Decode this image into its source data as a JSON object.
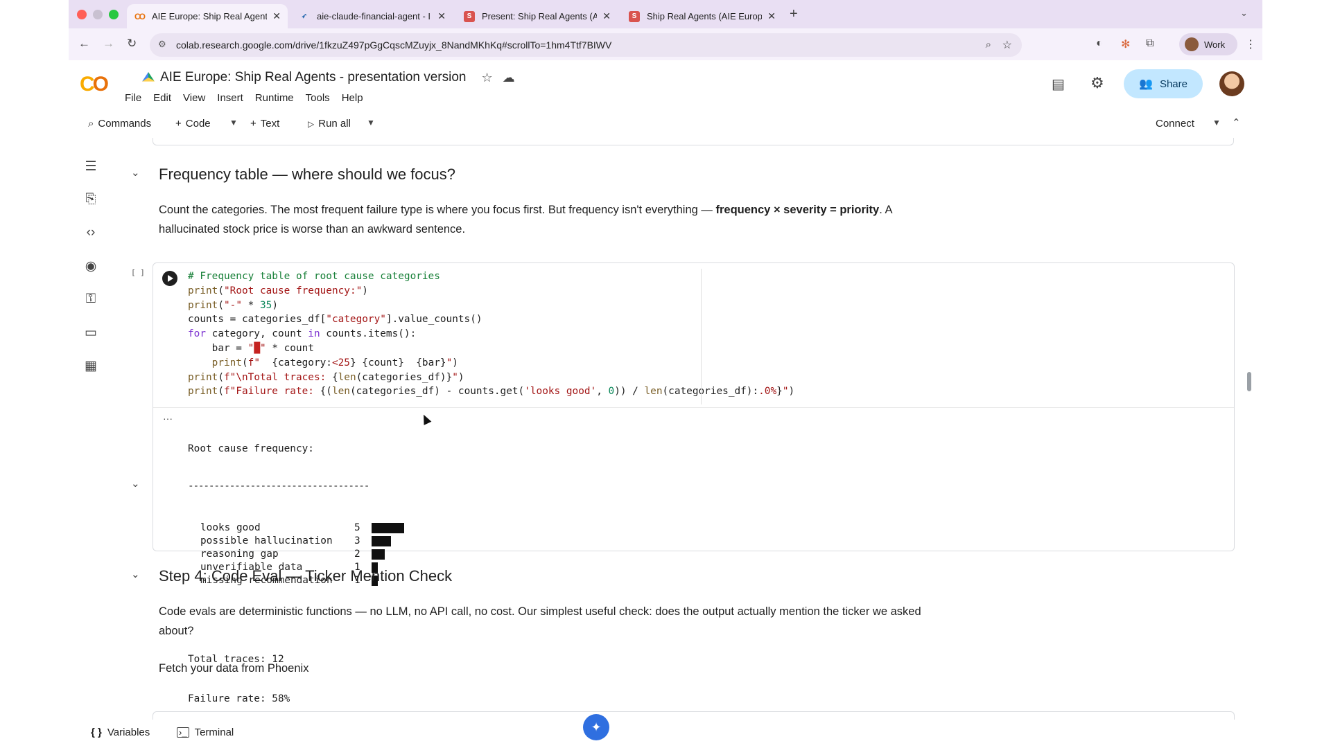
{
  "browser": {
    "tabs": [
      {
        "title": "AIE Europe: Ship Real Agents",
        "favicon": "colab-icon",
        "active": true
      },
      {
        "title": "aie-claude-financial-agent - I",
        "favicon": "phoenix-icon",
        "active": false
      },
      {
        "title": "Present: Ship Real Agents (A",
        "favicon": "slides-icon",
        "active": false
      },
      {
        "title": "Ship Real Agents (AIE Europe",
        "favicon": "slides-icon",
        "active": false
      }
    ],
    "url": "colab.research.google.com/drive/1fkzuZ497pGgCqscMZuyjx_8NandMKhKq#scrollTo=1hm4Ttf7BIWV",
    "profile_label": "Work"
  },
  "colab": {
    "logo": "CO",
    "notebook_title": "AIE Europe: Ship Real Agents - presentation version",
    "menu": [
      "File",
      "Edit",
      "View",
      "Insert",
      "Runtime",
      "Tools",
      "Help"
    ],
    "share_label": "Share",
    "toolbar": {
      "commands": "Commands",
      "code": "Code",
      "text": "Text",
      "run_all": "Run all",
      "connect": "Connect"
    }
  },
  "section_frequency": {
    "heading": "Frequency table — where should we focus?",
    "para_before": "Count the categories. The most frequent failure type is where you focus first. But frequency isn't everything — ",
    "para_bold": "frequency × severity = priority",
    "para_after": ". A hallucinated stock price is worse than an awkward sentence."
  },
  "code_cell": {
    "exec_count": "[ ]",
    "lines": [
      "# Frequency table of root cause categories",
      "print(\"Root cause frequency:\")",
      "print(\"-\" * 35)",
      "counts = categories_df[\"category\"].value_counts()",
      "for category, count in counts.items():",
      "    bar = \"█\" * count",
      "    print(f\"  {category:<25} {count}  {bar}\")",
      "print(f\"\\nTotal traces: {len(categories_df)}\")",
      "print(f\"Failure rate: {(len(categories_df) - counts.get('looks good', 0)) / len(categories_df):.0%}\")"
    ]
  },
  "output": {
    "title": "Root cause frequency:",
    "divider": "-----------------------------------",
    "rows": [
      {
        "category": "looks good",
        "count": 5
      },
      {
        "category": "possible hallucination",
        "count": 3
      },
      {
        "category": "reasoning gap",
        "count": 2
      },
      {
        "category": "unverifiable data",
        "count": 1
      },
      {
        "category": "missing recommendation",
        "count": 1
      }
    ],
    "total": "Total traces: 12",
    "failure_rate": "Failure rate: 58%"
  },
  "section_step4": {
    "heading": "Step 4: Code Eval — Ticker Mention Check",
    "para": "Code evals are deterministic functions — no LLM, no API call, no cost. Our simplest useful check: does the output actually mention the ticker we asked about?",
    "para2": "Fetch your data from Phoenix"
  },
  "bottom_bar": {
    "variables": "Variables",
    "terminal": "Terminal"
  }
}
